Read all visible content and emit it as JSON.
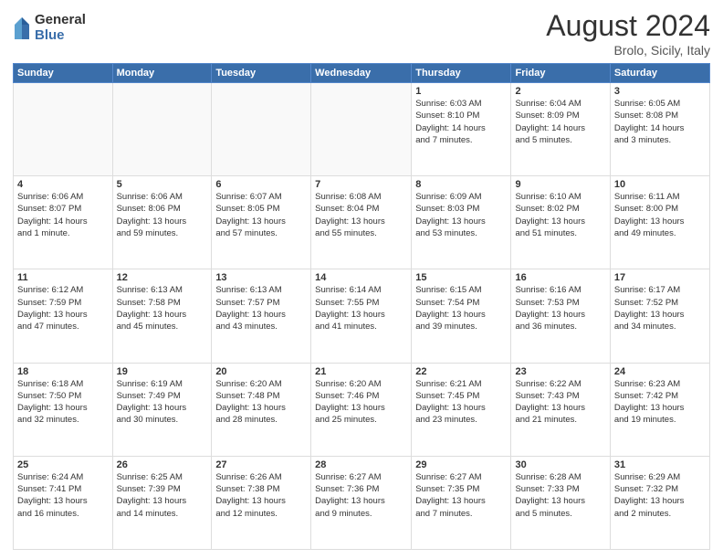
{
  "header": {
    "logo_general": "General",
    "logo_blue": "Blue",
    "month_title": "August 2024",
    "location": "Brolo, Sicily, Italy"
  },
  "weekdays": [
    "Sunday",
    "Monday",
    "Tuesday",
    "Wednesday",
    "Thursday",
    "Friday",
    "Saturday"
  ],
  "weeks": [
    [
      {
        "day": "",
        "text": "",
        "empty": true
      },
      {
        "day": "",
        "text": "",
        "empty": true
      },
      {
        "day": "",
        "text": "",
        "empty": true
      },
      {
        "day": "",
        "text": "",
        "empty": true
      },
      {
        "day": "1",
        "text": "Sunrise: 6:03 AM\nSunset: 8:10 PM\nDaylight: 14 hours\nand 7 minutes."
      },
      {
        "day": "2",
        "text": "Sunrise: 6:04 AM\nSunset: 8:09 PM\nDaylight: 14 hours\nand 5 minutes."
      },
      {
        "day": "3",
        "text": "Sunrise: 6:05 AM\nSunset: 8:08 PM\nDaylight: 14 hours\nand 3 minutes."
      }
    ],
    [
      {
        "day": "4",
        "text": "Sunrise: 6:06 AM\nSunset: 8:07 PM\nDaylight: 14 hours\nand 1 minute."
      },
      {
        "day": "5",
        "text": "Sunrise: 6:06 AM\nSunset: 8:06 PM\nDaylight: 13 hours\nand 59 minutes."
      },
      {
        "day": "6",
        "text": "Sunrise: 6:07 AM\nSunset: 8:05 PM\nDaylight: 13 hours\nand 57 minutes."
      },
      {
        "day": "7",
        "text": "Sunrise: 6:08 AM\nSunset: 8:04 PM\nDaylight: 13 hours\nand 55 minutes."
      },
      {
        "day": "8",
        "text": "Sunrise: 6:09 AM\nSunset: 8:03 PM\nDaylight: 13 hours\nand 53 minutes."
      },
      {
        "day": "9",
        "text": "Sunrise: 6:10 AM\nSunset: 8:02 PM\nDaylight: 13 hours\nand 51 minutes."
      },
      {
        "day": "10",
        "text": "Sunrise: 6:11 AM\nSunset: 8:00 PM\nDaylight: 13 hours\nand 49 minutes."
      }
    ],
    [
      {
        "day": "11",
        "text": "Sunrise: 6:12 AM\nSunset: 7:59 PM\nDaylight: 13 hours\nand 47 minutes."
      },
      {
        "day": "12",
        "text": "Sunrise: 6:13 AM\nSunset: 7:58 PM\nDaylight: 13 hours\nand 45 minutes."
      },
      {
        "day": "13",
        "text": "Sunrise: 6:13 AM\nSunset: 7:57 PM\nDaylight: 13 hours\nand 43 minutes."
      },
      {
        "day": "14",
        "text": "Sunrise: 6:14 AM\nSunset: 7:55 PM\nDaylight: 13 hours\nand 41 minutes."
      },
      {
        "day": "15",
        "text": "Sunrise: 6:15 AM\nSunset: 7:54 PM\nDaylight: 13 hours\nand 39 minutes."
      },
      {
        "day": "16",
        "text": "Sunrise: 6:16 AM\nSunset: 7:53 PM\nDaylight: 13 hours\nand 36 minutes."
      },
      {
        "day": "17",
        "text": "Sunrise: 6:17 AM\nSunset: 7:52 PM\nDaylight: 13 hours\nand 34 minutes."
      }
    ],
    [
      {
        "day": "18",
        "text": "Sunrise: 6:18 AM\nSunset: 7:50 PM\nDaylight: 13 hours\nand 32 minutes."
      },
      {
        "day": "19",
        "text": "Sunrise: 6:19 AM\nSunset: 7:49 PM\nDaylight: 13 hours\nand 30 minutes."
      },
      {
        "day": "20",
        "text": "Sunrise: 6:20 AM\nSunset: 7:48 PM\nDaylight: 13 hours\nand 28 minutes."
      },
      {
        "day": "21",
        "text": "Sunrise: 6:20 AM\nSunset: 7:46 PM\nDaylight: 13 hours\nand 25 minutes."
      },
      {
        "day": "22",
        "text": "Sunrise: 6:21 AM\nSunset: 7:45 PM\nDaylight: 13 hours\nand 23 minutes."
      },
      {
        "day": "23",
        "text": "Sunrise: 6:22 AM\nSunset: 7:43 PM\nDaylight: 13 hours\nand 21 minutes."
      },
      {
        "day": "24",
        "text": "Sunrise: 6:23 AM\nSunset: 7:42 PM\nDaylight: 13 hours\nand 19 minutes."
      }
    ],
    [
      {
        "day": "25",
        "text": "Sunrise: 6:24 AM\nSunset: 7:41 PM\nDaylight: 13 hours\nand 16 minutes."
      },
      {
        "day": "26",
        "text": "Sunrise: 6:25 AM\nSunset: 7:39 PM\nDaylight: 13 hours\nand 14 minutes."
      },
      {
        "day": "27",
        "text": "Sunrise: 6:26 AM\nSunset: 7:38 PM\nDaylight: 13 hours\nand 12 minutes."
      },
      {
        "day": "28",
        "text": "Sunrise: 6:27 AM\nSunset: 7:36 PM\nDaylight: 13 hours\nand 9 minutes."
      },
      {
        "day": "29",
        "text": "Sunrise: 6:27 AM\nSunset: 7:35 PM\nDaylight: 13 hours\nand 7 minutes."
      },
      {
        "day": "30",
        "text": "Sunrise: 6:28 AM\nSunset: 7:33 PM\nDaylight: 13 hours\nand 5 minutes."
      },
      {
        "day": "31",
        "text": "Sunrise: 6:29 AM\nSunset: 7:32 PM\nDaylight: 13 hours\nand 2 minutes."
      }
    ]
  ]
}
